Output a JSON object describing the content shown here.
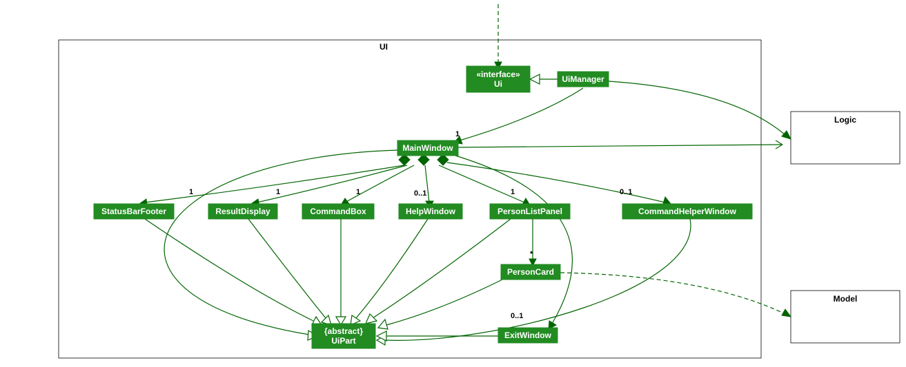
{
  "diagram": {
    "packages": {
      "ui": {
        "title": "UI"
      },
      "logic": {
        "title": "Logic"
      },
      "model": {
        "title": "Model"
      }
    },
    "nodes": {
      "ui_iface": {
        "stereo": "«interface»",
        "name": "Ui"
      },
      "ui_manager": {
        "name": "UiManager"
      },
      "main_window": {
        "name": "MainWindow"
      },
      "status_bar": {
        "name": "StatusBarFooter"
      },
      "result_disp": {
        "name": "ResultDisplay"
      },
      "cmd_box": {
        "name": "CommandBox"
      },
      "help_win": {
        "name": "HelpWindow"
      },
      "person_list": {
        "name": "PersonListPanel"
      },
      "cmd_helper": {
        "name": "CommandHelperWindow"
      },
      "person_card": {
        "name": "PersonCard"
      },
      "exit_win": {
        "name": "ExitWindow"
      },
      "ui_part": {
        "stereo": "{abstract}",
        "name": "UiPart"
      }
    },
    "multiplicities": {
      "mw": "1",
      "status": "1",
      "result": "1",
      "cmdbox": "1",
      "help": "0..1",
      "plist": "1",
      "cmdhelper": "0..1",
      "pcard": "*",
      "exit": "0..1"
    }
  }
}
